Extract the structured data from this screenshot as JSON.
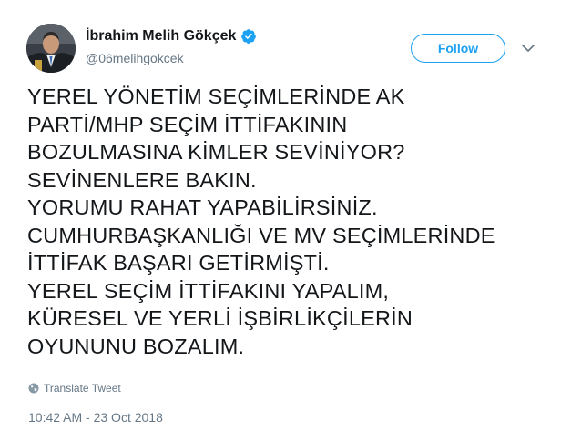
{
  "author": {
    "display_name": "İbrahim Melih Gökçek",
    "handle": "@06melihgokcek",
    "verified": true,
    "verified_color": "#1da1f2"
  },
  "actions": {
    "follow_label": "Follow",
    "more_icon": "chevron-down-icon"
  },
  "tweet": {
    "text": "YEREL YÖNETİM SEÇİMLERİNDE AK\nPARTİ/MHP SEÇİM İTTİFAKININ\nBOZULMASINA KİMLER SEVİNİYOR?\nSEVİNENLERE BAKIN.\nYORUMU RAHAT YAPABİLİRSİNİZ.\nCUMHURBAŞKANLIĞI VE MV SEÇİMLERİNDE\nİTTİFAK BAŞARI GETİRMİŞTİ.\nYEREL SEÇİM İTTİFAKINI YAPALIM,\nKÜRESEL VE YERLİ İŞBİRLİKÇİLERİN\nOYUNUNU BOZALIM.",
    "translate_label": "Translate Tweet",
    "translate_icon": "globe-icon",
    "timestamp": "10:42 AM - 23 Oct 2018"
  },
  "colors": {
    "accent": "#1da1f2",
    "text": "#14171a",
    "secondary": "#657786"
  }
}
